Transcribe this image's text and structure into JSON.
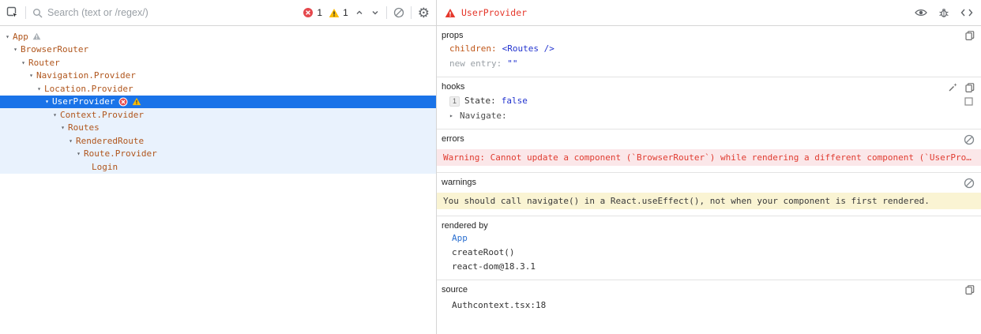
{
  "colors": {
    "selection_blue": "#1a73e8",
    "selection_subtree_bg": "#e9f2fd",
    "component_name": "#b0561d",
    "error_red": "#e5372b",
    "error_row_bg": "#fbe7e9",
    "warning_row_bg": "#faf4d3",
    "value_blue": "#2233cf",
    "warning_yellow": "#fbbc04"
  },
  "icons": {
    "expanded_arrow": "▾",
    "collapsed_arrow": "▸",
    "gear": "⚙"
  },
  "left_toolbar": {
    "search_placeholder": "Search (text or /regex/)",
    "error_count": "1",
    "warning_count": "1"
  },
  "tree": {
    "items": [
      {
        "label": "App",
        "level": 0
      },
      {
        "label": "BrowserRouter",
        "level": 1
      },
      {
        "label": "Router",
        "level": 2
      },
      {
        "label": "Navigation.Provider",
        "level": 3
      },
      {
        "label": "Location.Provider",
        "level": 4
      },
      {
        "label": "UserProvider",
        "level": 5,
        "selected": true
      },
      {
        "label": "Context.Provider",
        "level": 6
      },
      {
        "label": "Routes",
        "level": 7
      },
      {
        "label": "RenderedRoute",
        "level": 8
      },
      {
        "label": "Route.Provider",
        "level": 9
      },
      {
        "label": "Login",
        "level": 10,
        "leaf": true
      }
    ]
  },
  "inspector": {
    "title": "UserProvider",
    "props": {
      "heading": "props",
      "rows": [
        {
          "key": "children:",
          "value": "<Routes />"
        },
        {
          "key": "new entry:",
          "value": "\"\""
        }
      ]
    },
    "hooks": {
      "heading": "hooks",
      "state_index": "1",
      "state_label": "State:",
      "state_value": "false",
      "navigate_label": "Navigate:"
    },
    "errors": {
      "heading": "errors",
      "message": "Warning: Cannot update a component (`BrowserRouter`) while rendering a different component (`UserProvider`). To locate the …"
    },
    "warnings": {
      "heading": "warnings",
      "message": "You should call navigate() in a React.useEffect(), not when your component is first rendered."
    },
    "rendered_by": {
      "heading": "rendered by",
      "items": [
        "App",
        "createRoot()",
        "react-dom@18.3.1"
      ]
    },
    "source": {
      "heading": "source",
      "value": "Authcontext.tsx:18"
    }
  }
}
